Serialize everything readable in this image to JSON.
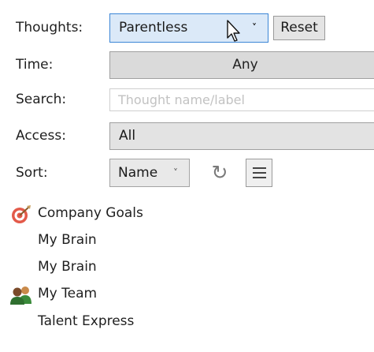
{
  "labels": {
    "thoughts": "Thoughts:",
    "time": "Time:",
    "search": "Search:",
    "access": "Access:",
    "sort": "Sort:"
  },
  "thoughts_filter": {
    "value": "Parentless",
    "chevron": "˅"
  },
  "reset_button": "Reset",
  "time_filter": "Any",
  "search": {
    "placeholder": "Thought name/label",
    "value": ""
  },
  "access_filter": "All",
  "sort": {
    "value": "Name",
    "chevron": "˅",
    "refresh_icon": "↻"
  },
  "tree": {
    "items": [
      {
        "label": "Company Goals",
        "icon": "target-icon"
      },
      {
        "label": "My Brain",
        "icon": ""
      },
      {
        "label": "My Brain",
        "icon": ""
      },
      {
        "label": "My Team",
        "icon": "team-icon"
      },
      {
        "label": "Talent Express",
        "icon": ""
      }
    ]
  },
  "colors": {
    "dropdown_hover_bg": "#dbe9f8",
    "dropdown_hover_border": "#3c86d6",
    "control_gray": "#dadada"
  }
}
